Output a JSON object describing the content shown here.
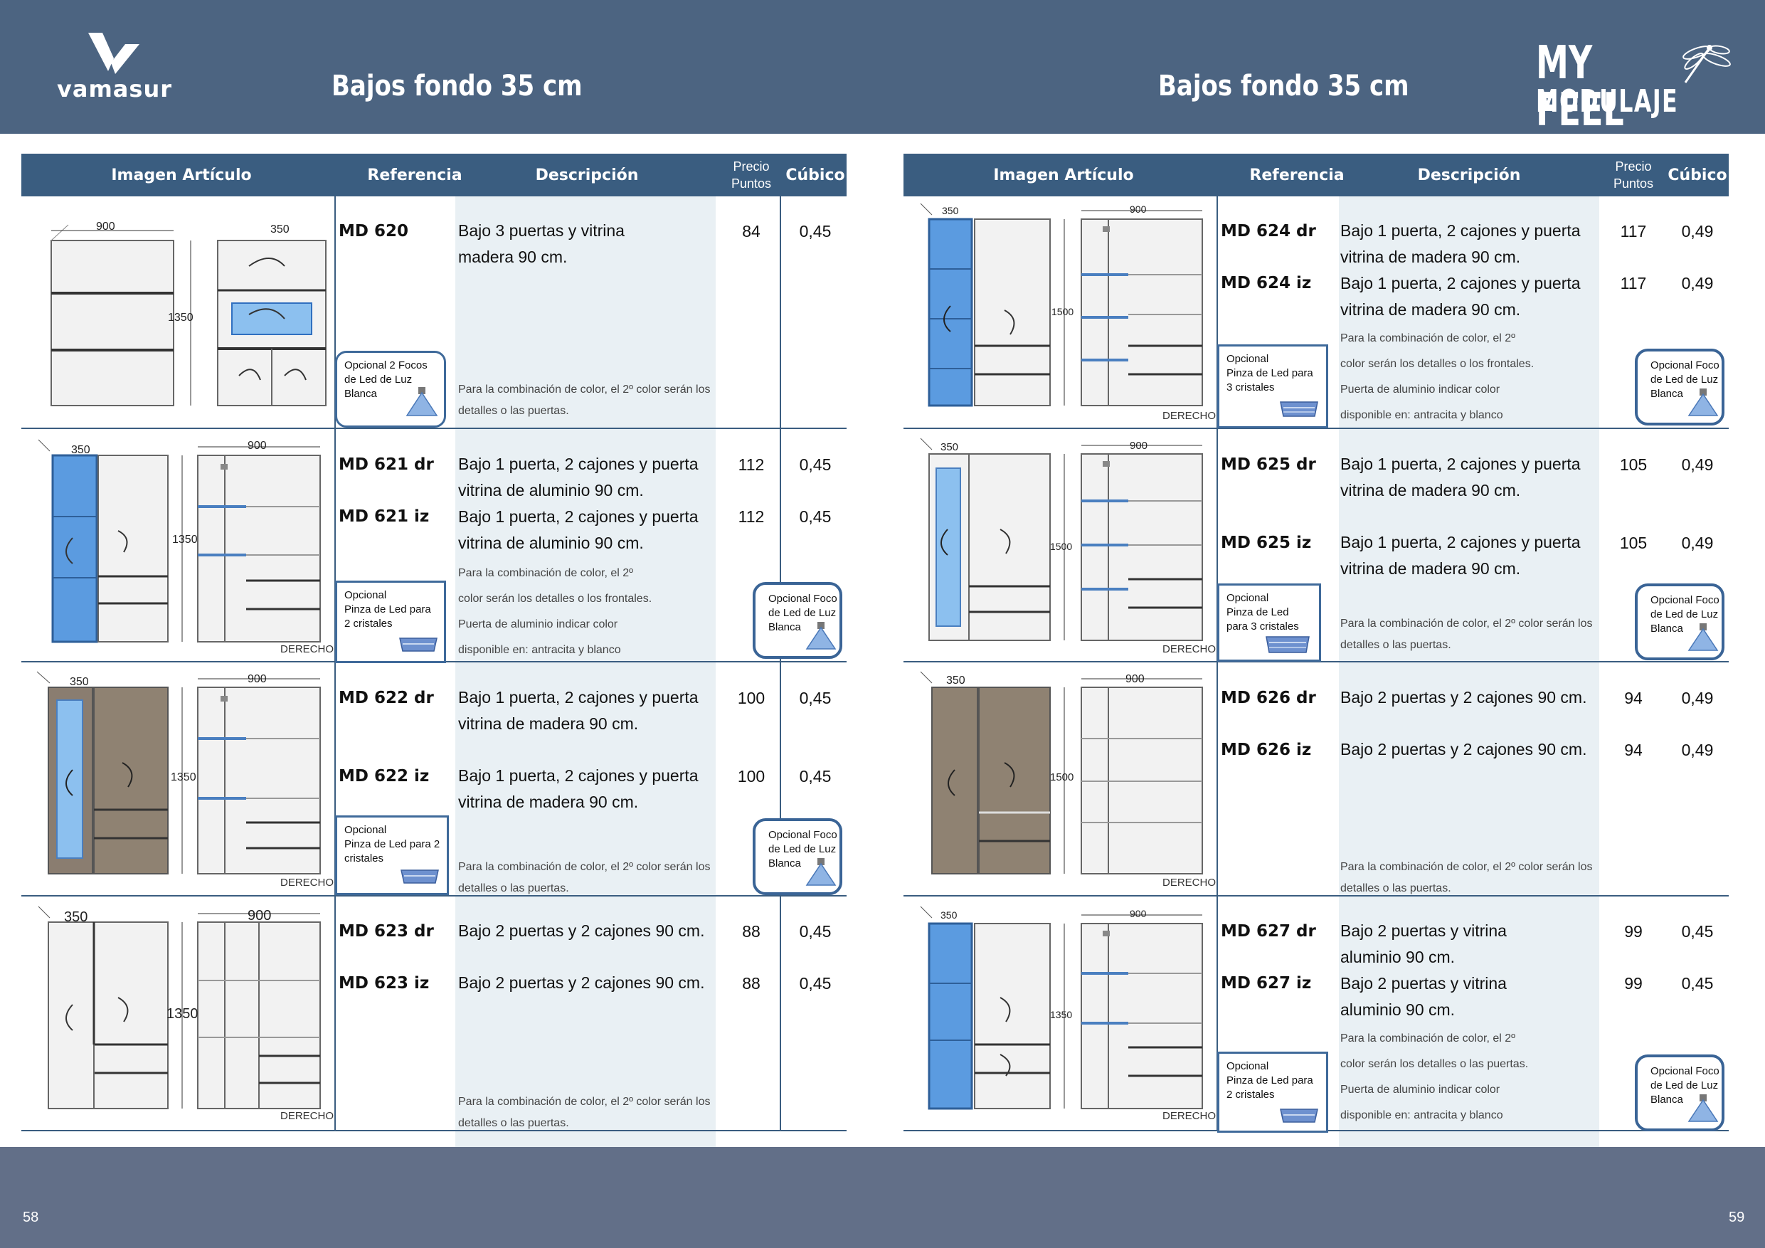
{
  "header": {
    "logo_text": "vamasur",
    "title_left": "Bajos fondo 35 cm",
    "title_right": "Bajos fondo 35 cm",
    "brand_line1": "MY FEEL",
    "brand_line2": "MODULAJE"
  },
  "footer": {
    "page_left": "58",
    "page_right": "59"
  },
  "table_header": {
    "image": "Imagen Artículo",
    "reference": "Referencia",
    "description": "Descripción",
    "price_line1": "Precio",
    "price_line2": "Puntos",
    "cubic": "Cúbico"
  },
  "colors": {
    "header_bar": "#4c6481",
    "table_header": "#3a5d80",
    "glass_blue": "#5b9be0",
    "wood": "#8a7d70",
    "light_panel": "#eef3f6"
  },
  "left_rows": [
    {
      "items": [
        {
          "ref": "MD 620",
          "desc1": "Bajo 3 puertas y vitrina",
          "desc2": "madera 90 cm.",
          "price": "84",
          "cubic": "0,45"
        }
      ],
      "note_lines": [
        "Para la combinación de color, el 2º color serán los",
        "detalles o las puertas."
      ],
      "option_lines": [
        "Opcional 2 Focos",
        "de Led de Luz",
        "Blanca"
      ],
      "dims": [
        "900",
        "350",
        "1350"
      ]
    },
    {
      "items": [
        {
          "ref": "MD 621 dr",
          "desc1": "Bajo 1 puerta, 2 cajones y puerta",
          "desc2": "vitrina de aluminio 90 cm.",
          "price": "112",
          "cubic": "0,45"
        },
        {
          "ref": "MD 621 iz",
          "desc1": "Bajo 1 puerta, 2 cajones y puerta",
          "desc2": "vitrina de aluminio 90 cm.",
          "price": "112",
          "cubic": "0,45"
        }
      ],
      "note_lines": [
        "Para la combinación de  color,  el  2º",
        "color serán los detalles o los frontales.",
        "Puerta de aluminio indicar color",
        "disponible en: antracita y blanco"
      ],
      "option_lines": [
        "Opcional",
        "Pinza de Led para",
        "2 cristales"
      ],
      "foco_lines": [
        "Opcional Foco",
        "de Led de Luz",
        "Blanca"
      ],
      "side_label": "DERECHO",
      "dims": [
        "350",
        "900",
        "1350"
      ]
    },
    {
      "items": [
        {
          "ref": "MD 622 dr",
          "desc1": "Bajo 1 puerta, 2 cajones y puerta",
          "desc2": "vitrina de madera 90 cm.",
          "price": "100",
          "cubic": "0,45"
        },
        {
          "ref": "MD 622 iz",
          "desc1": "Bajo 1 puerta, 2 cajones y puerta",
          "desc2": "vitrina de madera 90 cm.",
          "price": "100",
          "cubic": "0,45"
        }
      ],
      "note_lines": [
        "Para la combinación de color, el 2º color serán los",
        "detalles o las puertas."
      ],
      "option_lines": [
        "Opcional",
        "Pinza de Led para 2",
        "cristales"
      ],
      "foco_lines": [
        "Opcional Foco",
        "de Led de Luz",
        "Blanca"
      ],
      "side_label": "DERECHO",
      "dims": [
        "350",
        "900",
        "1350"
      ]
    },
    {
      "items": [
        {
          "ref": "MD 623 dr",
          "desc1": "Bajo 2 puertas y 2 cajones 90 cm.",
          "desc2": "",
          "price": "88",
          "cubic": "0,45"
        },
        {
          "ref": "MD 623 iz",
          "desc1": "Bajo 2 puertas y 2 cajones 90 cm.",
          "desc2": "",
          "price": "88",
          "cubic": "0,45"
        }
      ],
      "note_lines": [
        "Para la combinación de color, el 2º color serán los",
        "detalles o las puertas."
      ],
      "side_label": "DERECHO",
      "dims": [
        "350",
        "900",
        "1350"
      ]
    }
  ],
  "right_rows": [
    {
      "items": [
        {
          "ref": "MD 624 dr",
          "desc1": "Bajo 1 puerta, 2 cajones y puerta",
          "desc2": "vitrina de madera 90 cm.",
          "price": "117",
          "cubic": "0,49"
        },
        {
          "ref": "MD 624 iz",
          "desc1": "Bajo 1 puerta, 2 cajones y puerta",
          "desc2": "vitrina de madera 90 cm.",
          "price": "117",
          "cubic": "0,49"
        }
      ],
      "note_lines": [
        "Para la combinación de  color,  el  2º",
        "color serán los detalles o los frontales.",
        "Puerta de aluminio indicar color",
        "disponible en: antracita y blanco"
      ],
      "option_lines": [
        "Opcional",
        "Pinza de Led para",
        "3 cristales"
      ],
      "foco_lines": [
        "Opcional Foco",
        "de Led de Luz",
        "Blanca"
      ],
      "side_label": "DERECHO",
      "dims": [
        "350",
        "900",
        "1500"
      ]
    },
    {
      "items": [
        {
          "ref": "MD 625 dr",
          "desc1": "Bajo 1 puerta, 2 cajones y puerta",
          "desc2": "vitrina de madera 90 cm.",
          "price": "105",
          "cubic": "0,49"
        },
        {
          "ref": "MD 625 iz",
          "desc1": "Bajo 1 puerta, 2 cajones y puerta",
          "desc2": "vitrina de madera 90 cm.",
          "price": "105",
          "cubic": "0,49"
        }
      ],
      "note_lines": [
        "Para la combinación de color, el 2º color serán los",
        "detalles o las puertas."
      ],
      "option_lines": [
        "Opcional",
        "Pinza de Led",
        "para 3 cristales"
      ],
      "foco_lines": [
        "Opcional Foco",
        "de Led de Luz",
        "Blanca"
      ],
      "side_label": "DERECHO",
      "dims": [
        "350",
        "900",
        "1500"
      ]
    },
    {
      "items": [
        {
          "ref": "MD 626 dr",
          "desc1": "Bajo 2 puertas y 2 cajones 90 cm.",
          "desc2": "",
          "price": "94",
          "cubic": "0,49"
        },
        {
          "ref": "MD 626 iz",
          "desc1": "Bajo 2 puertas y 2 cajones 90 cm.",
          "desc2": "",
          "price": "94",
          "cubic": "0,49"
        }
      ],
      "note_lines": [
        "Para la combinación de color, el 2º color serán los",
        "detalles o las puertas."
      ],
      "side_label": "DERECHO",
      "dims": [
        "350",
        "900",
        "1500"
      ]
    },
    {
      "items": [
        {
          "ref": "MD 627 dr",
          "desc1": "Bajo 2 puertas y vitrina",
          "desc2": "aluminio 90 cm.",
          "price": "99",
          "cubic": "0,45"
        },
        {
          "ref": "MD 627 iz",
          "desc1": "Bajo 2 puertas y vitrina",
          "desc2": "aluminio 90 cm.",
          "price": "99",
          "cubic": "0,45"
        }
      ],
      "note_lines": [
        "Para la combinación de  color,  el  2º",
        "color serán los detalles o las puertas.",
        "Puerta de aluminio indicar color",
        "disponible en: antracita y blanco"
      ],
      "option_lines": [
        "Opcional",
        "Pinza de Led para",
        "2 cristales"
      ],
      "foco_lines": [
        "Opcional Foco",
        "de Led de Luz",
        "Blanca"
      ],
      "side_label": "DERECHO",
      "dims": [
        "350",
        "900",
        "1350"
      ]
    }
  ]
}
